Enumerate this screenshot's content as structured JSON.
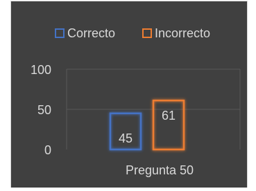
{
  "chart_data": {
    "type": "bar",
    "categories": [
      "Pregunta 50"
    ],
    "series": [
      {
        "name": "Correcto",
        "values": [
          45
        ],
        "color": "#4472c4"
      },
      {
        "name": "Incorrecto",
        "values": [
          61
        ],
        "color": "#ed7d31"
      }
    ],
    "yticks": [
      "0",
      "50",
      "100"
    ],
    "ylim": [
      0,
      100
    ],
    "legend_position": "top",
    "grid": true,
    "bar_style": "outlined-glow",
    "background_color": "#404040",
    "text_color": "#d9d9d9",
    "grid_color": "#595959"
  }
}
